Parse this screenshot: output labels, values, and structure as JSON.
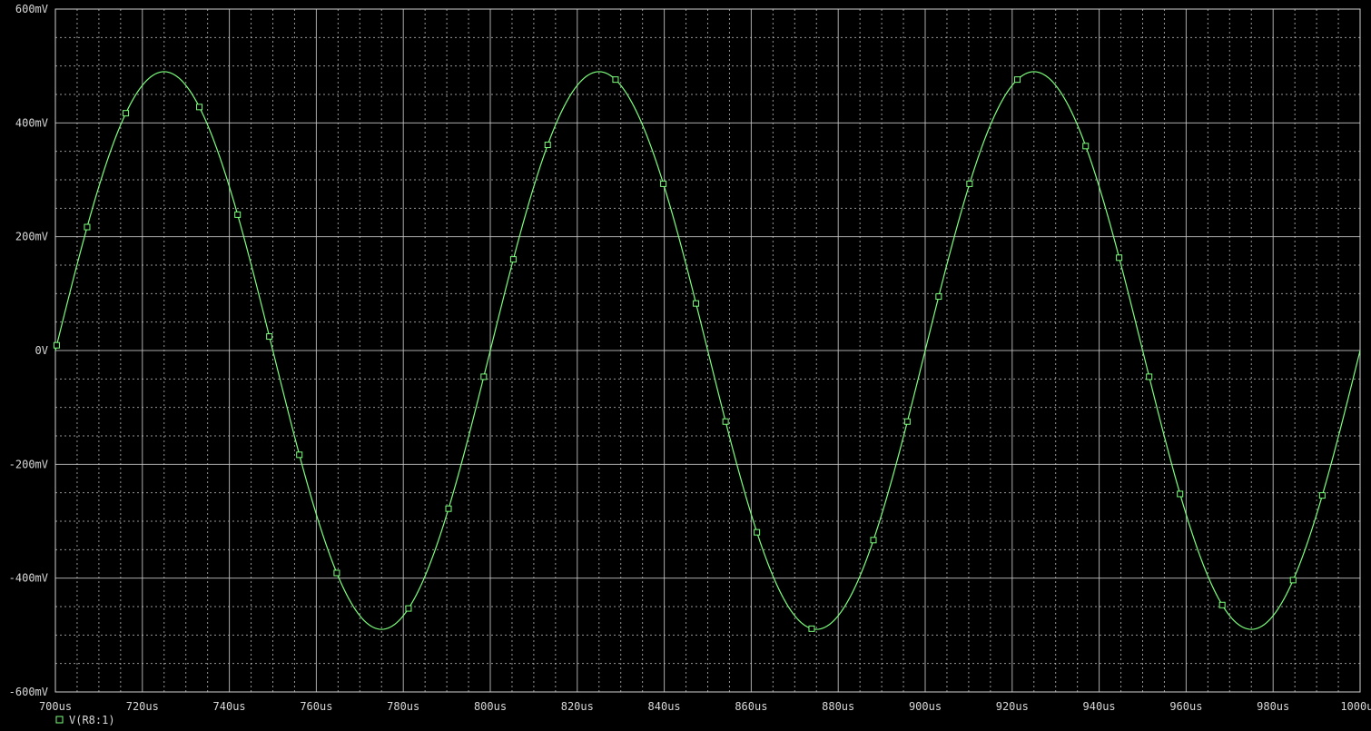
{
  "chart_data": {
    "type": "line",
    "title": "",
    "xlabel": "",
    "ylabel": "",
    "xlim": [
      700,
      1000
    ],
    "ylim": [
      -600,
      600
    ],
    "x_ticks": [
      700,
      720,
      740,
      760,
      780,
      800,
      820,
      840,
      860,
      880,
      900,
      920,
      940,
      960,
      980,
      1000
    ],
    "x_tick_labels": [
      "700us",
      "720us",
      "740us",
      "760us",
      "780us",
      "800us",
      "820us",
      "840us",
      "860us",
      "880us",
      "900us",
      "920us",
      "940us",
      "960us",
      "980us",
      "1000us"
    ],
    "y_ticks": [
      -600,
      -400,
      -200,
      0,
      200,
      400,
      600
    ],
    "y_tick_labels": [
      "-600mV",
      "-400mV",
      "-200mV",
      "0V",
      "200mV",
      "400mV",
      "600mV"
    ],
    "grid": true,
    "legend_position": "bottom-left",
    "colors": {
      "background": "#000000",
      "trace": "#7cff7c",
      "grid": "#c8c8c8",
      "text": "#d8d8d8"
    },
    "series": [
      {
        "name": "V(R8:1)",
        "description": "sinusoid, amplitude 490 mV, frequency 10 kHz (period 100 us), zero crossing rising near 700 us",
        "amplitude_mV": 490,
        "period_us": 100,
        "x": [
          700,
          710,
          720,
          725,
          730,
          740,
          750,
          760,
          770,
          775,
          780,
          790,
          800,
          810,
          820,
          825,
          830,
          840,
          850,
          860,
          870,
          875,
          880,
          890,
          900,
          910,
          920,
          925,
          930,
          940,
          950,
          960,
          970,
          975,
          980,
          990,
          1000
        ],
        "y": [
          10,
          290,
          465,
          490,
          465,
          290,
          0,
          -290,
          -465,
          -490,
          -465,
          -290,
          0,
          290,
          465,
          490,
          465,
          290,
          0,
          -290,
          -465,
          -490,
          -465,
          -290,
          0,
          290,
          465,
          490,
          465,
          290,
          0,
          -290,
          -465,
          -490,
          -465,
          -290,
          0
        ],
        "marker_x": [
          700.3,
          707.3,
          716.2,
          733.1,
          741.9,
          749.2,
          756.1,
          764.7,
          781.2,
          790.4,
          798.5,
          805.3,
          813.2,
          828.8,
          839.8,
          847.3,
          854.1,
          861.3,
          873.9,
          888.1,
          895.9,
          903.1,
          910.2,
          921.2,
          936.9,
          944.6,
          951.5,
          958.6,
          968.3,
          984.6,
          991.3
        ]
      }
    ]
  }
}
